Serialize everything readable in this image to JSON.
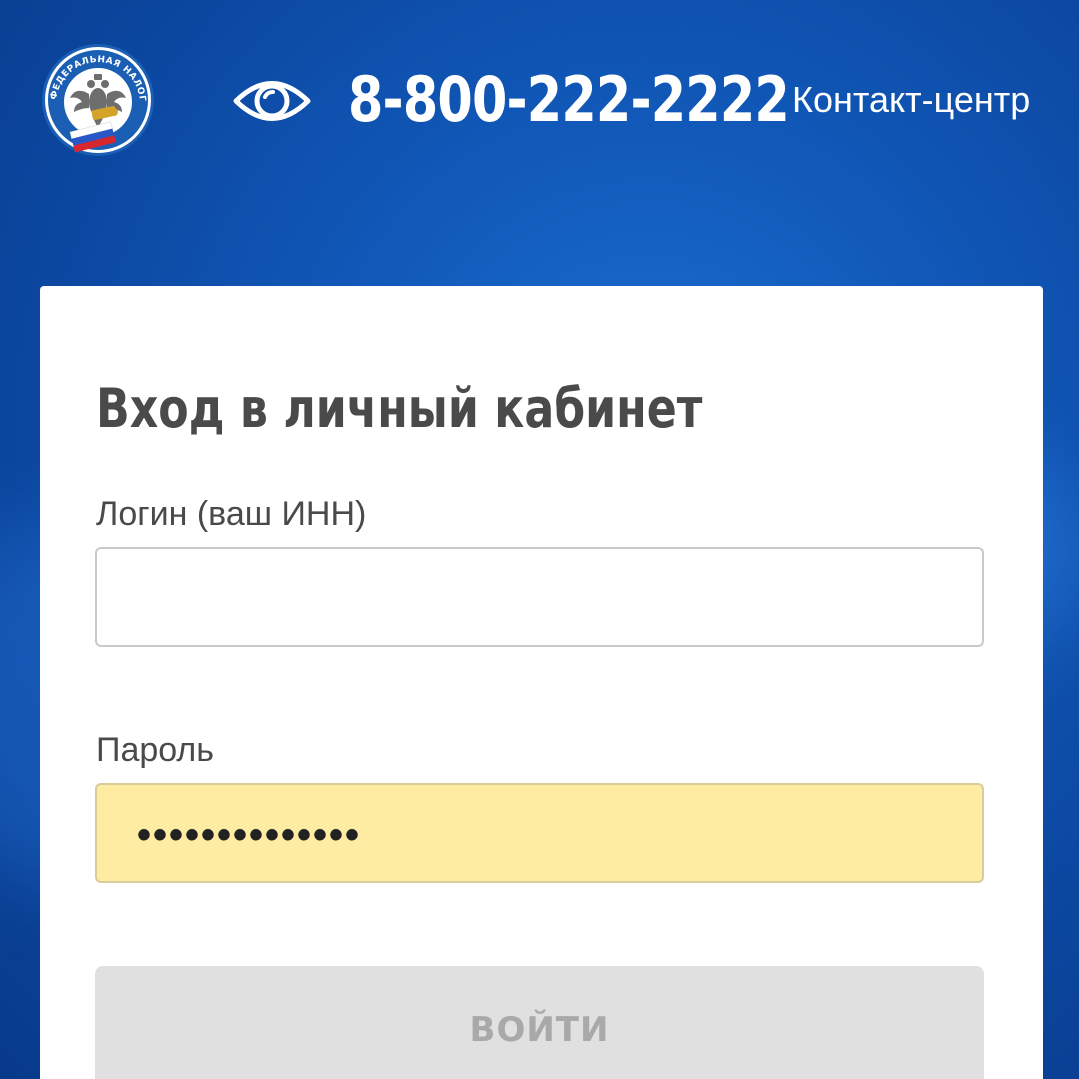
{
  "header": {
    "logo_name": "fns-emblem",
    "logo_text": "ФЕДЕРАЛЬНАЯ НАЛОГОВАЯ СЛУЖБА",
    "accessibility_icon": "eye-icon",
    "phone": "8-800-222-2222",
    "contact_label": "Контакт-центр"
  },
  "login_form": {
    "title": "Вход в личный кабинет",
    "login_label": "Логин (ваш ИНН)",
    "login_value": "",
    "password_label": "Пароль",
    "password_value": "••••••••••••••",
    "submit_label": "ВОЙТИ"
  },
  "colors": {
    "background": "#1158b8",
    "card": "#ffffff",
    "autofill": "#fdeca2",
    "button_disabled": "#e0e0e0",
    "button_text_disabled": "#a9a9a9",
    "title_text": "#4a4a4a"
  }
}
